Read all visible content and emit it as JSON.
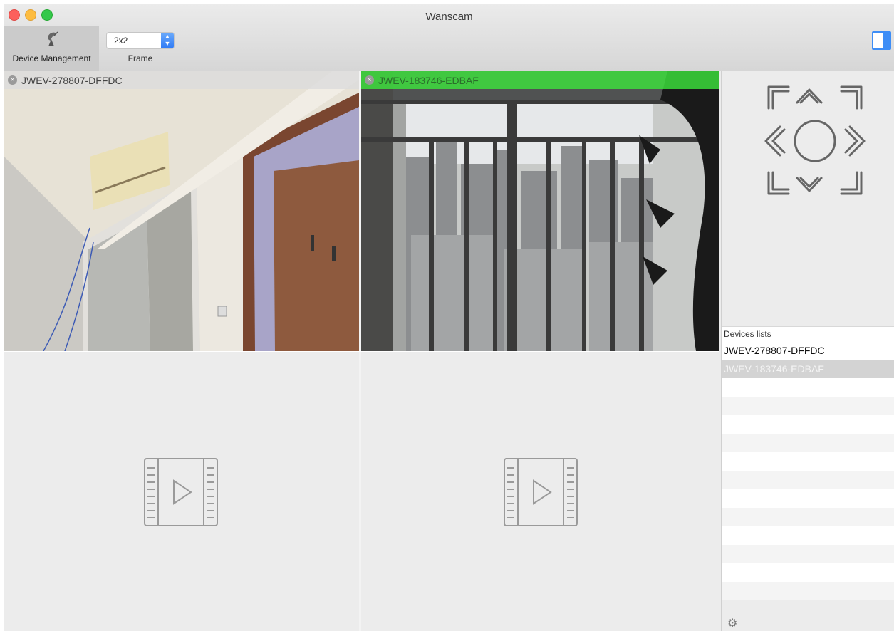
{
  "window": {
    "title": "Wanscam"
  },
  "toolbar": {
    "device_management_label": "Device Management",
    "frame_value": "2x2",
    "frame_label": "Frame"
  },
  "cells": [
    {
      "name": "JWEV-278807-DFFDC",
      "state": "live",
      "close_glyph": "×"
    },
    {
      "name": "JWEV-183746-EDBAF",
      "state": "live",
      "close_glyph": "×"
    },
    {
      "state": "empty"
    },
    {
      "state": "empty"
    }
  ],
  "devices": {
    "header": "Devices lists",
    "items": [
      {
        "label": "JWEV-278807-DFFDC",
        "selected": false
      },
      {
        "label": "JWEV-183746-EDBAF",
        "selected": true
      }
    ]
  },
  "icons": {
    "device_management": "satellite-dish-icon",
    "ptz": [
      "ptz-up-left-icon",
      "ptz-up-icon",
      "ptz-up-right-icon",
      "ptz-left-icon",
      "ptz-center-icon",
      "ptz-right-icon",
      "ptz-down-left-icon",
      "ptz-down-icon",
      "ptz-down-right-icon"
    ],
    "video_placeholder": "film-play-icon",
    "settings": "gear-icon",
    "gear_glyph": "⚙"
  },
  "colors": {
    "accent": "#3d8df6",
    "active_cell_header": "#3ce63c",
    "selected_row": "#d3d3d3"
  }
}
